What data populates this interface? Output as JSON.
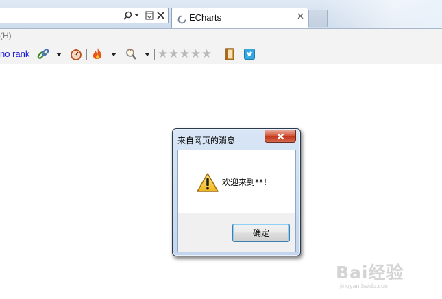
{
  "browser": {
    "tab": {
      "title": "ECharts"
    },
    "menu": {
      "help_fragment": "(H)"
    },
    "toolbar": {
      "rank_link": "no rank",
      "star_count": 5
    }
  },
  "dialog": {
    "title": "来自网页的消息",
    "message": "欢迎来到**！",
    "ok_label": "确定"
  },
  "watermark": {
    "brand": "Bai经验",
    "url": "jingyan.baidu.com"
  },
  "colors": {
    "link": "#1a1ad6",
    "dialog_frame": "#c3d6ee",
    "close_button": "#c3391e",
    "star": "#b9b9b9"
  },
  "icons": [
    "search-icon",
    "dropdown-icon",
    "compat-view-icon",
    "close-icon",
    "loading-icon",
    "link-icon",
    "gauge-icon",
    "fire-icon",
    "magnifier-icon",
    "star-icon",
    "notepad-icon",
    "twitter-icon",
    "warning-icon"
  ]
}
